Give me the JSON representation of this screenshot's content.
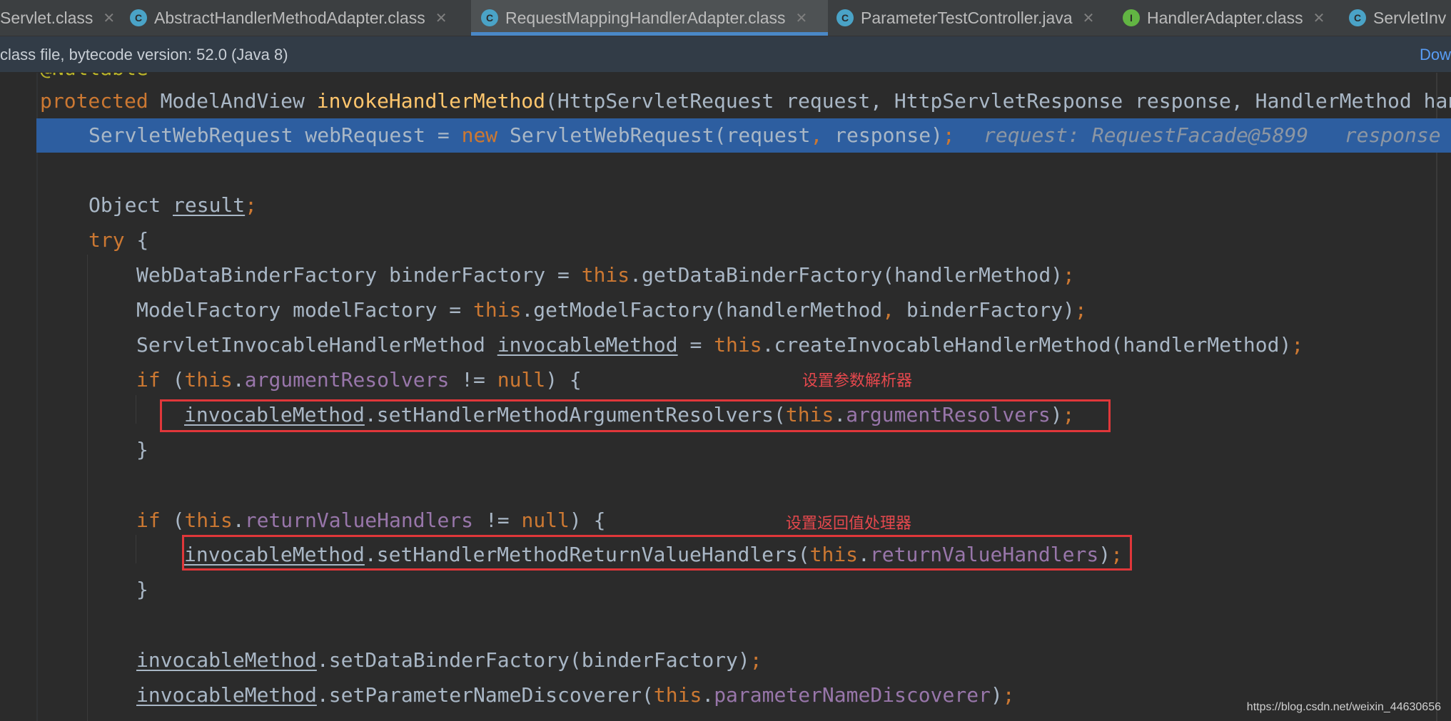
{
  "tabs": [
    {
      "label": "Servlet.class",
      "icon": "class-icon",
      "close": "✕"
    },
    {
      "label": "AbstractHandlerMethodAdapter.class",
      "icon": "class-icon",
      "close": "✕"
    },
    {
      "label": "RequestMappingHandlerAdapter.class",
      "icon": "class-icon",
      "close": "✕",
      "active": true
    },
    {
      "label": "ParameterTestController.java",
      "icon": "class-icon",
      "close": "✕"
    },
    {
      "label": "HandlerAdapter.class",
      "icon": "interface-icon",
      "close": "✕"
    },
    {
      "label": "ServletInv",
      "icon": "class-icon"
    }
  ],
  "tab_icon_glyphs": {
    "class": "C",
    "interface": "I"
  },
  "infobar": {
    "message": "class file, bytecode version: 52.0 (Java 8)",
    "link": "Dow"
  },
  "code": {
    "annotation": "@Nullable",
    "l1": {
      "kw": "protected",
      "type": "ModelAndView",
      "name": "invokeHandlerMethod",
      "rest": "(HttpServletRequest request, HttpServletResponse response, HandlerMethod han"
    },
    "l2": {
      "a": "ServletWebRequest webRequest = ",
      "kw": "new",
      "b": " ServletWebRequest(request",
      "comma": ",",
      "c": " response)",
      "semi": ";",
      "hint1": "request: RequestFacade@5899",
      "hint2": "response"
    },
    "l3": {
      "a": "Object ",
      "var": "result",
      "semi": ";"
    },
    "l4": {
      "kw": "try",
      "b": " {"
    },
    "l5": {
      "a": "WebDataBinderFactory binderFactory = ",
      "kw": "this",
      "b": ".getDataBinderFactory(handlerMethod)",
      "semi": ";"
    },
    "l6": {
      "a": "ModelFactory modelFactory = ",
      "kw": "this",
      "b": ".getModelFactory(handlerMethod",
      "comma": ",",
      "c": " binderFactory)",
      "semi": ";"
    },
    "l7": {
      "a": "ServletInvocableHandlerMethod ",
      "var": "invocableMethod",
      "b": " = ",
      "kw": "this",
      "c": ".createInvocableHandlerMethod(handlerMethod)",
      "semi": ";"
    },
    "l8": {
      "kw": "if",
      "a": " (",
      "kw2": "this",
      "dot": ".",
      "field": "argumentResolvers",
      "b": " != ",
      "kw3": "null",
      "c": ") {"
    },
    "l9": {
      "var": "invocableMethod",
      "a": ".setHandlerMethodArgumentResolvers(",
      "kw": "this",
      "dot": ".",
      "field": "argumentResolvers",
      "b": ")",
      "semi": ";"
    },
    "l10": {
      "a": "}"
    },
    "l11": {
      "kw": "if",
      "a": " (",
      "kw2": "this",
      "dot": ".",
      "field": "returnValueHandlers",
      "b": " != ",
      "kw3": "null",
      "c": ") {"
    },
    "l12": {
      "var": "invocableMethod",
      "a": ".setHandlerMethodReturnValueHandlers(",
      "kw": "this",
      "dot": ".",
      "field": "returnValueHandlers",
      "b": ")",
      "semi": ";"
    },
    "l13": {
      "a": "}"
    },
    "l14": {
      "var": "invocableMethod",
      "a": ".setDataBinderFactory(binderFactory)",
      "semi": ";"
    },
    "l15": {
      "var": "invocableMethod",
      "a": ".setParameterNameDiscoverer(",
      "kw": "this",
      "dot": ".",
      "field": "parameterNameDiscoverer",
      "b": ")",
      "semi": ";"
    }
  },
  "annotations": {
    "note1": "设置参数解析器",
    "note2": "设置返回值处理器"
  },
  "watermark": "https://blog.csdn.net/weixin_44630656",
  "colors": {
    "background": "#2b2b2b",
    "keyword": "#cc7832",
    "method_decl": "#ffc66d",
    "field": "#9876aa",
    "execution_line": "#2d5ea0",
    "annotation_box": "#e0373a"
  }
}
